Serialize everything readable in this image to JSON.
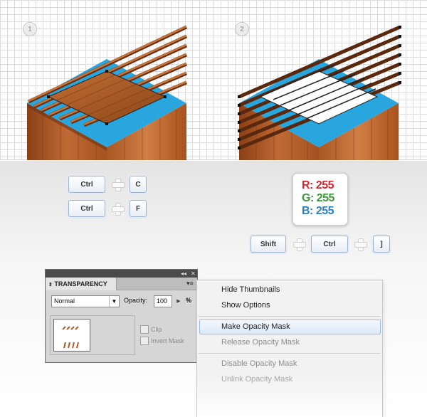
{
  "steps": [
    "1",
    "2"
  ],
  "shortcuts": {
    "copy": [
      "Ctrl",
      "C"
    ],
    "paste_front": [
      "Ctrl",
      "F"
    ],
    "bring_front": [
      "Shift",
      "Ctrl",
      "]"
    ]
  },
  "rgb": {
    "r": "R: 255",
    "g": "G: 255",
    "b": "B: 255"
  },
  "colors": {
    "r": "#d8262e",
    "g": "#3a9a3c",
    "b": "#2a7fc0",
    "blue_top": "#2aa6df",
    "wood_dark": "#7a3d18",
    "wood_light": "#c46a32"
  },
  "panel": {
    "title": "TRANSPARENCY",
    "blend_mode": "Normal",
    "opacity_label": "Opacity:",
    "opacity_value": "100",
    "percent": "%",
    "clip_label": "Clip",
    "invert_label": "Invert Mask"
  },
  "menu": {
    "items": [
      "Hide Thumbnails",
      "Show Options",
      "Make Opacity Mask",
      "Release Opacity Mask",
      "Disable Opacity Mask",
      "Unlink Opacity Mask"
    ],
    "icons": [
      "collapse-icon",
      "close-icon",
      "panel-menu-icon"
    ]
  }
}
